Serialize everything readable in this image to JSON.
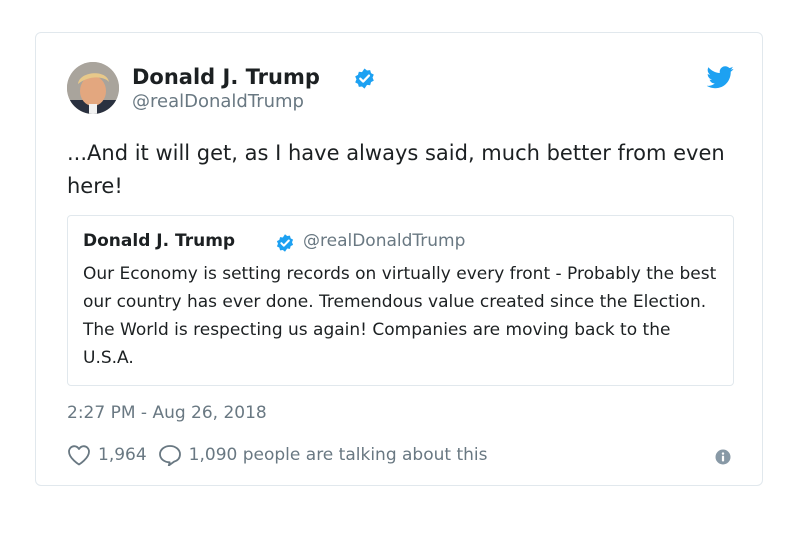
{
  "tweet": {
    "author": {
      "name": "Donald J. Trump",
      "handle": "@realDonaldTrump",
      "verified": true
    },
    "text": "...And it will get, as I have always said, much better from even here!",
    "quoted_tweet": {
      "author_name": "Donald J. Trump",
      "author_handle": "@realDonaldTrump",
      "verified": true,
      "text": "Our Economy is setting records on virtually every front - Probably the best our country has ever done. Tremendous value created since the Election. The World is respecting us again! Companies are moving back to the U.S.A."
    },
    "timestamp": "2:27 PM - Aug 26, 2018",
    "likes_count": "1,964",
    "talking_text": "1,090 people are talking about this"
  },
  "icons": {
    "brand": "twitter-bird-icon",
    "verified": "verified-badge-icon",
    "like": "heart-icon",
    "reply": "speech-bubble-icon",
    "info": "info-icon"
  },
  "colors": {
    "twitter_blue": "#1da1f2",
    "text": "#1c2022",
    "secondary_text": "#697882",
    "border": "#e1e8ed"
  }
}
